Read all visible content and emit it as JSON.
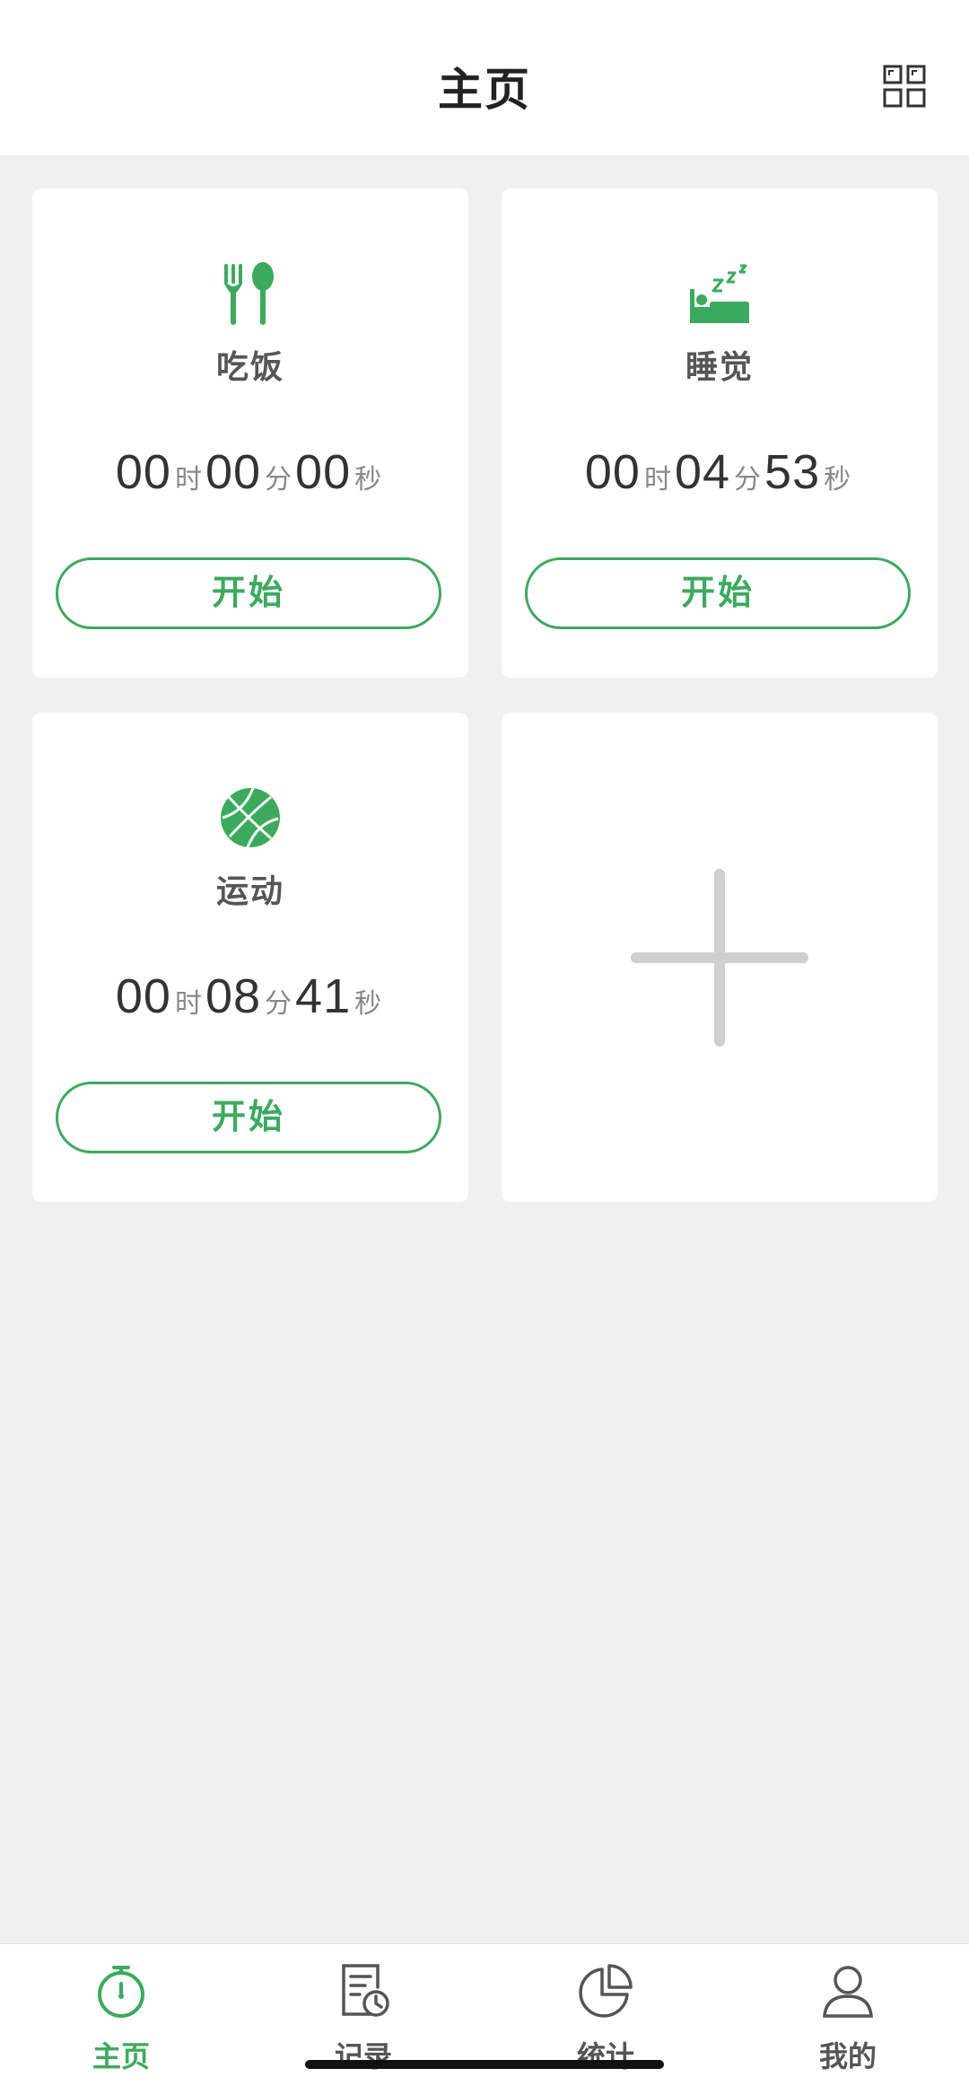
{
  "header": {
    "title": "主页"
  },
  "cards": [
    {
      "title": "吃饭",
      "icon": "fork-spoon-icon",
      "hours": "00",
      "minutes": "00",
      "seconds": "00",
      "button": "开始"
    },
    {
      "title": "睡觉",
      "icon": "sleep-bed-icon",
      "hours": "00",
      "minutes": "04",
      "seconds": "53",
      "button": "开始"
    },
    {
      "title": "运动",
      "icon": "basketball-icon",
      "hours": "00",
      "minutes": "08",
      "seconds": "41",
      "button": "开始"
    }
  ],
  "units": {
    "hour": "时",
    "minute": "分",
    "second": "秒"
  },
  "add_card": {
    "icon": "plus-icon"
  },
  "tabs": [
    {
      "label": "主页",
      "icon": "stopwatch-icon",
      "active": true
    },
    {
      "label": "记录",
      "icon": "record-document-icon",
      "active": false
    },
    {
      "label": "统计",
      "icon": "pie-chart-icon",
      "active": false
    },
    {
      "label": "我的",
      "icon": "user-icon",
      "active": false
    }
  ],
  "colors": {
    "accent": "#3aab5c",
    "background": "#f0f0f0",
    "card": "#ffffff"
  }
}
